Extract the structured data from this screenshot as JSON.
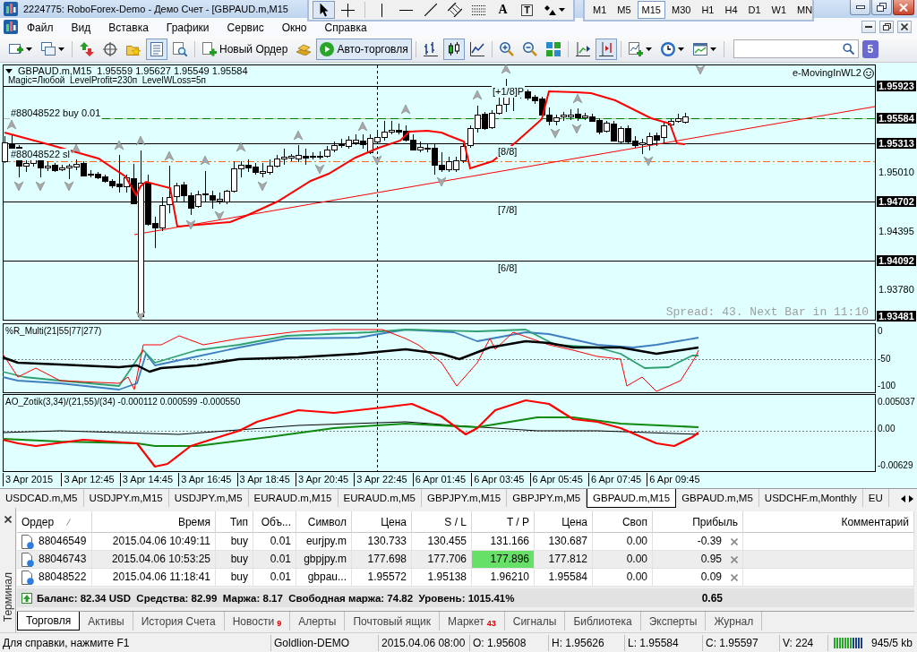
{
  "window": {
    "title": "2224775: RoboForex-Demo - Демо Счет - [GBPAUD.m,M15"
  },
  "drawing_toolbar": [
    {
      "tools": [
        {
          "kind": "cursor",
          "selected": true
        },
        {
          "kind": "crosshair",
          "selected": false
        }
      ]
    },
    {
      "tools": [
        {
          "kind": "vertical-line",
          "selected": false
        },
        {
          "kind": "horizontal-line",
          "selected": false
        },
        {
          "kind": "trend-line",
          "selected": false
        },
        {
          "kind": "channel",
          "selected": false
        },
        {
          "kind": "fibo",
          "selected": false
        },
        {
          "kind": "text",
          "label": "A",
          "selected": false
        },
        {
          "kind": "text-label",
          "label": "T",
          "selected": false
        },
        {
          "kind": "arrows",
          "selected": false
        }
      ]
    }
  ],
  "timeframes": [
    {
      "label": "M1",
      "selected": false
    },
    {
      "label": "M5",
      "selected": false
    },
    {
      "label": "M15",
      "selected": true
    },
    {
      "label": "M30",
      "selected": false
    },
    {
      "label": "H1",
      "selected": false
    },
    {
      "label": "H4",
      "selected": false
    },
    {
      "label": "D1",
      "selected": false
    },
    {
      "label": "W1",
      "selected": false
    },
    {
      "label": "MN",
      "selected": false
    }
  ],
  "menu": [
    "Файл",
    "Вид",
    "Вставка",
    "Графики",
    "Сервис",
    "Окно",
    "Справка"
  ],
  "toolbar": [
    {
      "buttons": [
        {
          "kind": "new-chart",
          "pressed": false
        },
        {
          "kind": "profiles",
          "pressed": false
        }
      ]
    },
    {
      "buttons": [
        {
          "kind": "market-watch",
          "pressed": false
        },
        {
          "kind": "navigator",
          "pressed": false
        },
        {
          "kind": "favorites",
          "pressed": false
        },
        {
          "kind": "terminal",
          "pressed": true
        },
        {
          "kind": "tester",
          "pressed": false
        }
      ]
    },
    {
      "buttons": [
        {
          "kind": "new-order",
          "label": "Новый Ордер",
          "pressed": false
        },
        {
          "kind": "editor",
          "pressed": false
        },
        {
          "kind": "auto-trading",
          "label": "Авто-торговля",
          "pressed": true
        }
      ]
    },
    {
      "buttons": [
        {
          "kind": "bar-chart",
          "pressed": false
        },
        {
          "kind": "candlesticks",
          "pressed": true
        },
        {
          "kind": "line-chart",
          "pressed": false
        }
      ]
    },
    {
      "buttons": [
        {
          "kind": "zoom-in",
          "pressed": false
        },
        {
          "kind": "zoom-out",
          "pressed": false
        },
        {
          "kind": "tile",
          "pressed": false
        }
      ]
    },
    {
      "buttons": [
        {
          "kind": "chart-shift",
          "pressed": false
        },
        {
          "kind": "auto-scroll",
          "pressed": true
        }
      ]
    },
    {
      "buttons": [
        {
          "kind": "indicators",
          "pressed": false
        },
        {
          "kind": "periods",
          "pressed": false
        },
        {
          "kind": "templates",
          "pressed": false
        }
      ]
    }
  ],
  "notification_count": "5",
  "chart": {
    "symbol": "GBPAUD.m,M15",
    "ohlc": "1.95559 1.95627 1.95549 1.95584",
    "expert_params": "Magic=Любой  LevelProfit=230п  LevelWLoss=5п",
    "expert_name": "e-MovingInWL2",
    "order_line_label": "#88048522 buy 0.01",
    "stop_loss_label": "#88048522 sl",
    "level_labels": [
      "[+1/8]P",
      "[8/8]",
      "[7/8]",
      "[6/8]"
    ],
    "spread_info": "Spread: 43. Next Bar in 11:10",
    "price_axis": [
      {
        "label": "1.95923",
        "boxed": true
      },
      {
        "label": "1.95584",
        "boxed": true
      },
      {
        "label": "1.95313",
        "boxed": true
      },
      {
        "label": "1.95010",
        "boxed": false
      },
      {
        "label": "1.94702",
        "boxed": true
      },
      {
        "label": "1.94395",
        "boxed": false
      },
      {
        "label": "1.94092",
        "boxed": true
      },
      {
        "label": "1.93780",
        "boxed": false
      },
      {
        "label": "1.93481",
        "boxed": true
      }
    ],
    "indicators": [
      {
        "kind": "williams-r",
        "title": "%R_Multi(21|55|77|277)",
        "axis": [
          "0",
          "-50",
          "-100"
        ]
      },
      {
        "kind": "awesome-oscillator",
        "title": "AO_Zotik(3,34)/(21,55)/(34) -0.000112 0.000599 -0.000550",
        "axis": [
          "0.005037",
          "0.00",
          "-0.00629"
        ]
      }
    ],
    "time_axis": [
      "3 Apr 2015",
      "3 Apr 12:45",
      "3 Apr 14:45",
      "3 Apr 16:45",
      "3 Apr 18:45",
      "3 Apr 20:45",
      "3 Apr 22:45",
      "6 Apr 01:45",
      "6 Apr 03:45",
      "6 Apr 05:45",
      "6 Apr 07:45",
      "6 Apr 09:45"
    ]
  },
  "chart_tabs": [
    {
      "label": "USDCAD.m,M5",
      "selected": false
    },
    {
      "label": "USDJPY.m,M15",
      "selected": false
    },
    {
      "label": "USDJPY.m,M5",
      "selected": false
    },
    {
      "label": "EURAUD.m,M15",
      "selected": false
    },
    {
      "label": "EURAUD.m,M5",
      "selected": false
    },
    {
      "label": "GBPJPY.m,M15",
      "selected": false
    },
    {
      "label": "GBPJPY.m,M5",
      "selected": false
    },
    {
      "label": "GBPAUD.m,M15",
      "selected": true
    },
    {
      "label": "GBPAUD.m,M5",
      "selected": false
    },
    {
      "label": "USDCHF.m,Monthly",
      "selected": false
    },
    {
      "label": "EU",
      "selected": false
    }
  ],
  "terminal": {
    "title": "Терминал",
    "columns": [
      {
        "label": "Ордер",
        "sorted": true
      },
      {
        "label": "Время",
        "sorted": false
      },
      {
        "label": "Тип",
        "sorted": false
      },
      {
        "label": "Объ...",
        "sorted": false
      },
      {
        "label": "Символ",
        "sorted": false
      },
      {
        "label": "Цена",
        "sorted": false
      },
      {
        "label": "S / L",
        "sorted": false
      },
      {
        "label": "T / P",
        "sorted": false
      },
      {
        "label": "Цена",
        "sorted": false
      },
      {
        "label": "Своп",
        "sorted": false
      },
      {
        "label": "Прибыль",
        "sorted": false
      },
      {
        "label": "Комментарий",
        "sorted": false
      }
    ],
    "rows": [
      {
        "order": "88046549",
        "time": "2015.04.06 10:49:11",
        "type": "buy",
        "volume": "0.01",
        "symbol": "eurjpy.m",
        "open_price": "130.733",
        "sl": "130.455",
        "tp": "131.166",
        "price": "130.687",
        "swap": "0.00",
        "profit": "-0.39",
        "tp_highlighted": false
      },
      {
        "order": "88046743",
        "time": "2015.04.06 10:53:25",
        "type": "buy",
        "volume": "0.01",
        "symbol": "gbpjpy.m",
        "open_price": "177.698",
        "sl": "177.706",
        "tp": "177.896",
        "price": "177.812",
        "swap": "0.00",
        "profit": "0.95",
        "tp_highlighted": true
      },
      {
        "order": "88048522",
        "time": "2015.04.06 11:18:41",
        "type": "buy",
        "volume": "0.01",
        "symbol": "gbpau...",
        "open_price": "1.95572",
        "sl": "1.95138",
        "tp": "1.96210",
        "price": "1.95584",
        "swap": "0.00",
        "profit": "0.09",
        "tp_highlighted": false
      }
    ],
    "summary": "Баланс: 82.34 USD  Средства: 82.99  Маржа: 8.17  Свободная маржа: 74.82  Уровень: 1015.41%",
    "total_profit": "0.65",
    "tabs": [
      {
        "label": "Торговля",
        "selected": true
      },
      {
        "label": "Активы",
        "selected": false
      },
      {
        "label": "История Счета",
        "selected": false
      },
      {
        "label": "Новости",
        "badge": "9",
        "selected": false
      },
      {
        "label": "Алерты",
        "selected": false
      },
      {
        "label": "Почтовый ящик",
        "selected": false
      },
      {
        "label": "Маркет",
        "badge": "43",
        "selected": false
      },
      {
        "label": "Сигналы",
        "selected": false
      },
      {
        "label": "Библиотека",
        "selected": false
      },
      {
        "label": "Эксперты",
        "selected": false
      },
      {
        "label": "Журнал",
        "selected": false
      }
    ]
  },
  "status_bar": {
    "segments": [
      "Для справки, нажмите F1",
      "Goldlion-DEMO",
      "2015.04.06 08:00",
      "O: 1.95608",
      "H: 1.95626",
      "L: 1.95584",
      "C: 1.95597",
      "V: 224"
    ],
    "traffic": "945/5 kb"
  }
}
